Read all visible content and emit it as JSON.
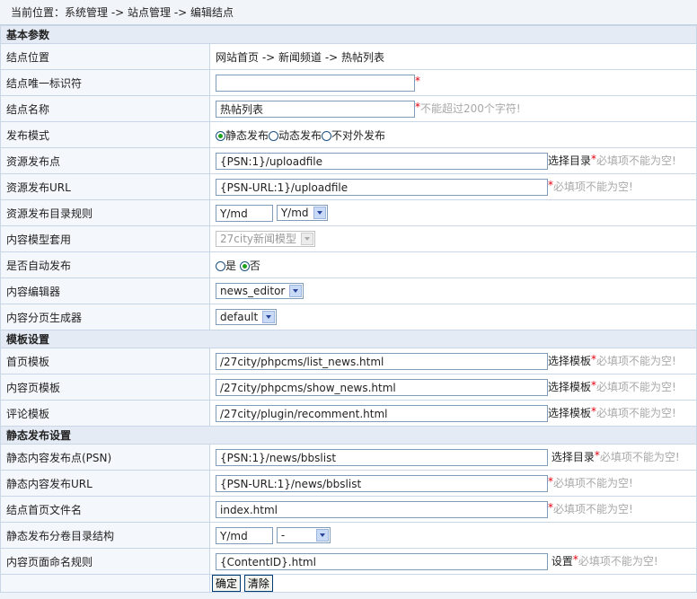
{
  "breadcrumb": "当前位置：系统管理 -> 站点管理 -> 编辑结点",
  "sections": {
    "basic": "基本参数",
    "template": "模板设置",
    "static": "静态发布设置"
  },
  "basic": {
    "location_label": "结点位置",
    "location_value": "网站首页 -> 新闻频道 -> 热帖列表",
    "uid_label": "结点唯一标识符",
    "uid_value": "",
    "name_label": "结点名称",
    "name_value": "热帖列表",
    "name_hint": "不能超过200个字符!",
    "publish_mode_label": "发布模式",
    "publish_mode_options": [
      "静态发布",
      "动态发布",
      "不对外发布"
    ],
    "publish_mode_selected": "静态发布",
    "res_point_label": "资源发布点",
    "res_point_value": "{PSN:1}/uploadfile",
    "res_point_action": "选择目录",
    "res_url_label": "资源发布URL",
    "res_url_value": "{PSN-URL:1}/uploadfile",
    "res_dir_rule_label": "资源发布目录规则",
    "res_dir_rule_value": "Y/md",
    "res_dir_rule_select": "Y/md",
    "content_model_label": "内容模型套用",
    "content_model_value": "27city新闻模型",
    "auto_publish_label": "是否自动发布",
    "auto_publish_yes": "是",
    "auto_publish_no": "否",
    "editor_label": "内容编辑器",
    "editor_value": "news_editor",
    "paginator_label": "内容分页生成器",
    "paginator_value": "default"
  },
  "template": {
    "index_label": "首页模板",
    "index_value": "/27city/phpcms/list_news.html",
    "content_label": "内容页模板",
    "content_value": "/27city/phpcms/show_news.html",
    "comment_label": "评论模板",
    "comment_value": "/27city/plugin/recomment.html",
    "action": "选择模板"
  },
  "static": {
    "psn_label": "静态内容发布点(PSN)",
    "psn_value": "{PSN:1}/news/bbslist",
    "psn_action": "选择目录",
    "url_label": "静态内容发布URL",
    "url_value": "{PSN-URL:1}/news/bbslist",
    "index_file_label": "结点首页文件名",
    "index_file_value": "index.html",
    "vol_label": "静态发布分卷目录结构",
    "vol_value": "Y/md",
    "vol_select": "-",
    "naming_label": "内容页面命名规则",
    "naming_value": "{ContentID}.html",
    "naming_action": "设置"
  },
  "required_mark": "*",
  "required_hint": "必填项不能为空!",
  "buttons": {
    "ok": "确定",
    "clear": "清除"
  },
  "colors": {
    "required": "#e0000e",
    "hint": "#a8a8a8",
    "section_bg": "#e4ebf4",
    "radio_dot": "#21a121"
  }
}
